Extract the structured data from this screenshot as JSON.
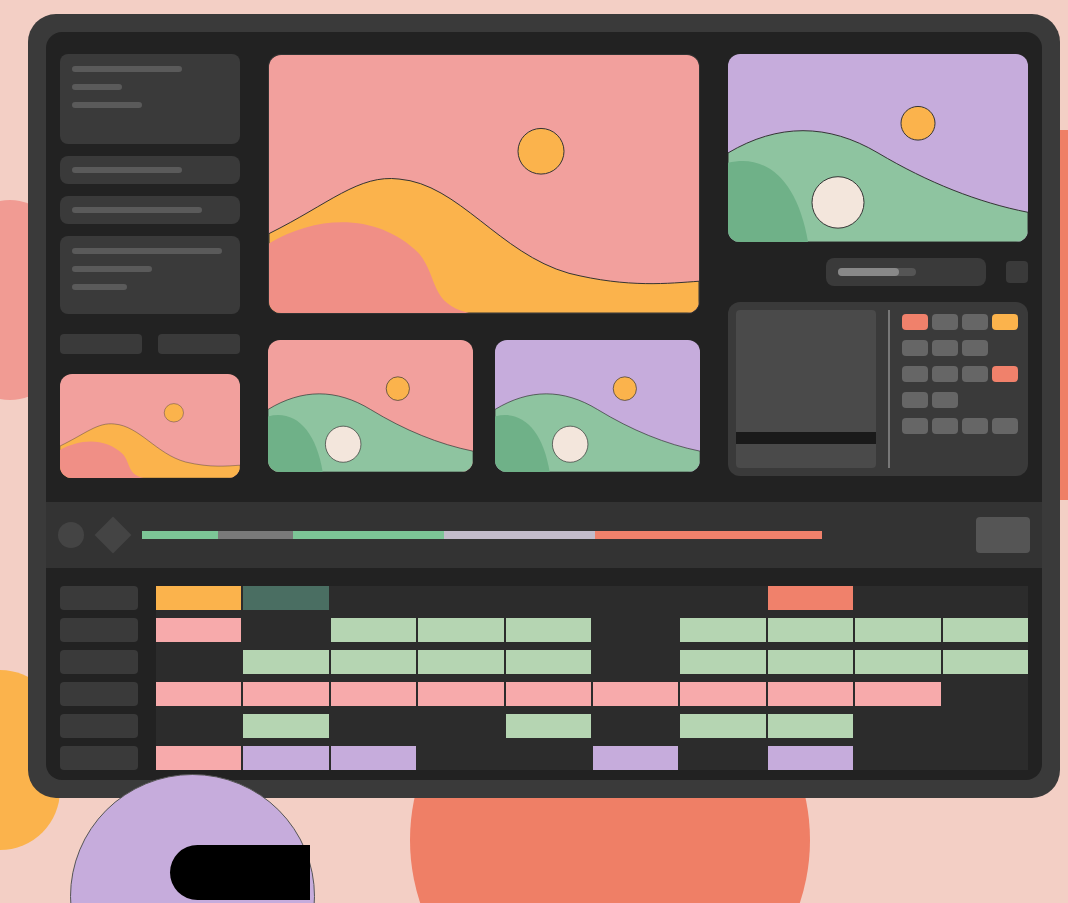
{
  "preview": {
    "kind": "dune",
    "color": "#f2a09d"
  },
  "side_preview": {
    "kind": "hills",
    "color": "#c6acdc"
  },
  "thumbnails": [
    {
      "kind": "dune",
      "color": "#f2a09d"
    },
    {
      "kind": "hills",
      "color": "#f2a09d"
    },
    {
      "kind": "hills",
      "color": "#c6acdc"
    }
  ],
  "render_progress": {
    "level": 0.78
  },
  "scrubber": [
    {
      "color": "#7cc596"
    },
    {
      "color": "#7a7a7a"
    },
    {
      "color": "#7cc596"
    },
    {
      "color": "#7cc596"
    },
    {
      "color": "#c3bccb"
    },
    {
      "color": "#c3bccb"
    },
    {
      "color": "#f0816b"
    },
    {
      "color": "#f0816b"
    },
    {
      "color": "#f0816b"
    }
  ],
  "tracks": [
    {
      "clips": [
        {
          "kind": "clip",
          "color": "#fbb34c"
        },
        {
          "kind": "clip",
          "color": "#4a6e62"
        },
        {
          "kind": "gap"
        },
        {
          "kind": "gap"
        },
        {
          "kind": "gap"
        },
        {
          "kind": "gap"
        },
        {
          "kind": "gap"
        },
        {
          "kind": "clip",
          "color": "#f0816b"
        },
        {
          "kind": "gap"
        },
        {
          "kind": "gap"
        }
      ]
    },
    {
      "clips": [
        {
          "kind": "clip",
          "color": "#f7aaab"
        },
        {
          "kind": "gap"
        },
        {
          "kind": "clip",
          "color": "#b5d5b2"
        },
        {
          "kind": "clip",
          "color": "#b5d5b2"
        },
        {
          "kind": "clip",
          "color": "#b5d5b2"
        },
        {
          "kind": "gap"
        },
        {
          "kind": "clip",
          "color": "#b5d5b2"
        },
        {
          "kind": "clip",
          "color": "#b5d5b2"
        },
        {
          "kind": "clip",
          "color": "#b5d5b2"
        },
        {
          "kind": "clip",
          "color": "#b5d5b2"
        }
      ]
    },
    {
      "clips": [
        {
          "kind": "gap"
        },
        {
          "kind": "clip",
          "color": "#b5d5b2"
        },
        {
          "kind": "clip",
          "color": "#b5d5b2"
        },
        {
          "kind": "clip",
          "color": "#b5d5b2"
        },
        {
          "kind": "clip",
          "color": "#b5d5b2"
        },
        {
          "kind": "gap"
        },
        {
          "kind": "clip",
          "color": "#b5d5b2"
        },
        {
          "kind": "clip",
          "color": "#b5d5b2"
        },
        {
          "kind": "clip",
          "color": "#b5d5b2"
        },
        {
          "kind": "clip",
          "color": "#b5d5b2"
        }
      ]
    },
    {
      "clips": [
        {
          "kind": "clip",
          "color": "#f7aaab"
        },
        {
          "kind": "clip",
          "color": "#f7aaab"
        },
        {
          "kind": "clip",
          "color": "#f7aaab"
        },
        {
          "kind": "clip",
          "color": "#f7aaab"
        },
        {
          "kind": "clip",
          "color": "#f7aaab"
        },
        {
          "kind": "clip",
          "color": "#f7aaab"
        },
        {
          "kind": "clip",
          "color": "#f7aaab"
        },
        {
          "kind": "clip",
          "color": "#f7aaab"
        },
        {
          "kind": "clip",
          "color": "#f7aaab"
        },
        {
          "kind": "gap"
        }
      ]
    },
    {
      "clips": [
        {
          "kind": "gap"
        },
        {
          "kind": "clip",
          "color": "#b5d5b2"
        },
        {
          "kind": "gap"
        },
        {
          "kind": "gap"
        },
        {
          "kind": "clip",
          "color": "#b5d5b2"
        },
        {
          "kind": "gap"
        },
        {
          "kind": "clip",
          "color": "#b5d5b2"
        },
        {
          "kind": "clip",
          "color": "#b5d5b2"
        },
        {
          "kind": "gap"
        },
        {
          "kind": "gap"
        }
      ]
    },
    {
      "clips": [
        {
          "kind": "clip",
          "color": "#f7aaab"
        },
        {
          "kind": "clip",
          "color": "#c6acdc"
        },
        {
          "kind": "clip",
          "color": "#c6acdc"
        },
        {
          "kind": "gap"
        },
        {
          "kind": "gap"
        },
        {
          "kind": "clip",
          "color": "#c6acdc"
        },
        {
          "kind": "gap"
        },
        {
          "kind": "clip",
          "color": "#c6acdc"
        },
        {
          "kind": "gap"
        },
        {
          "kind": "gap"
        }
      ]
    }
  ]
}
